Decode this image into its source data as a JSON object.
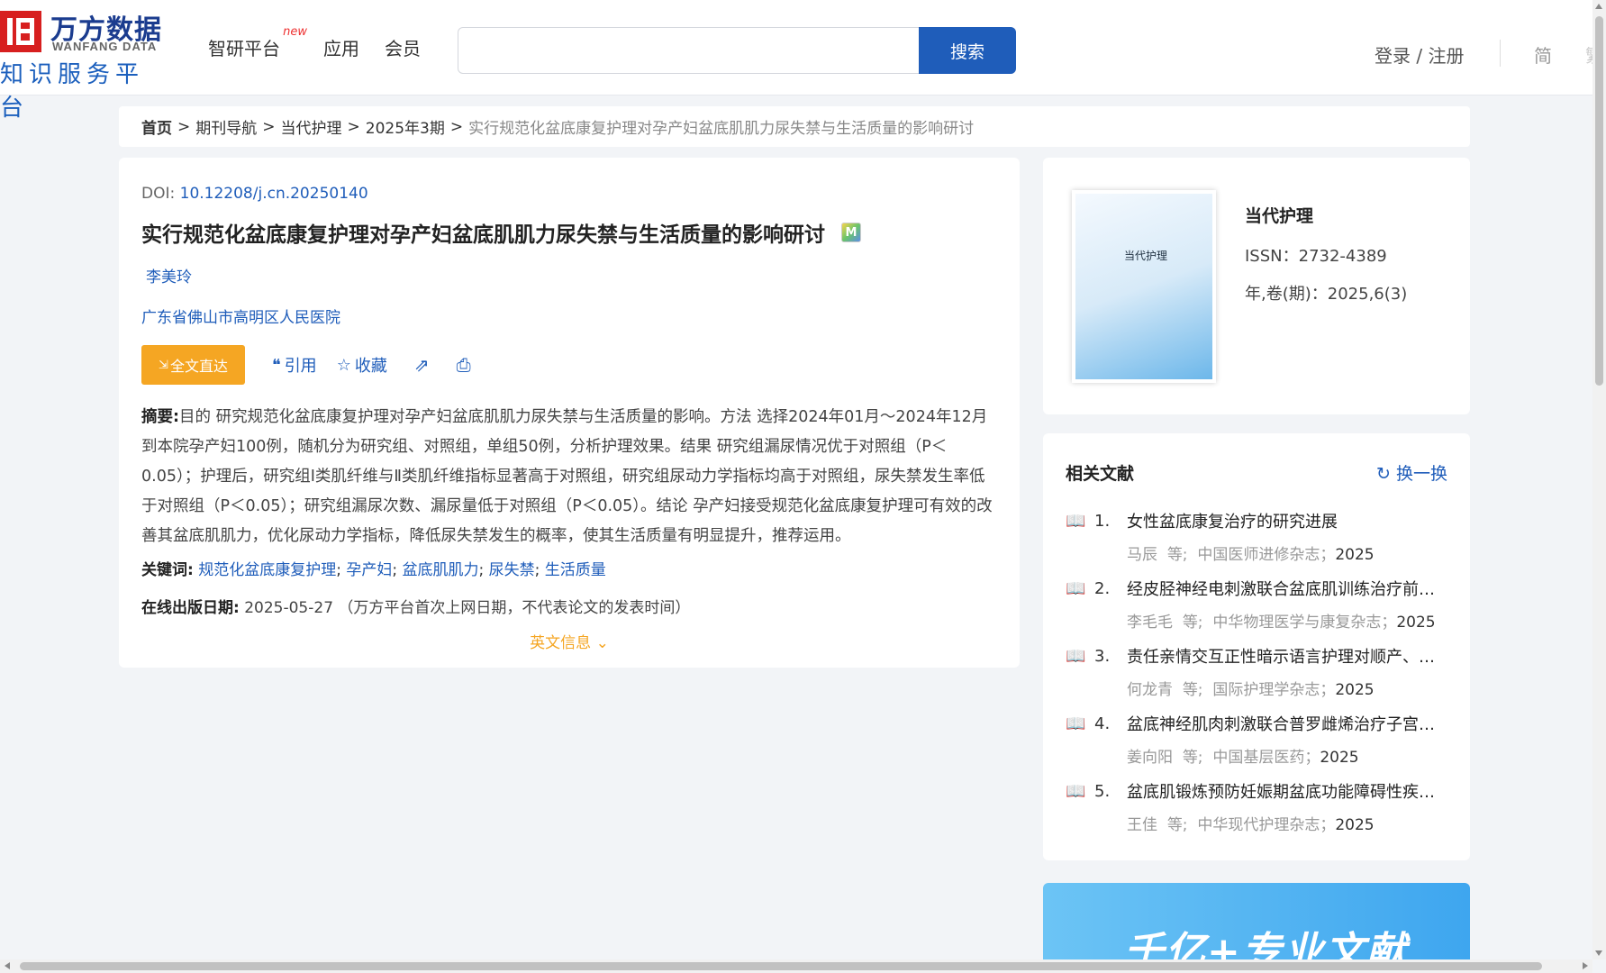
{
  "header": {
    "logo_cn": "万方数据",
    "logo_en": "WANFANG DATA",
    "logo_sub": "知识服务平台",
    "nav": [
      {
        "label": "智研平台",
        "tag": "new"
      },
      {
        "label": "应用"
      },
      {
        "label": "会员"
      }
    ],
    "search": {
      "placeholder": "",
      "button": "搜索"
    },
    "login": "登录 / 注册",
    "lang_simplified": "简",
    "lang_traditional": "繁"
  },
  "breadcrumb": {
    "home": "首页",
    "items": [
      "期刊导航",
      "当代护理",
      "2025年3期"
    ],
    "current": "实行规范化盆底康复护理对孕产妇盆底肌肌力尿失禁与生活质量的影响研讨",
    "sep": ">"
  },
  "article": {
    "doi_label": "DOI: ",
    "doi": "10.12208/j.cn.20250140",
    "title": "实行规范化盆底康复护理对孕产妇盆底肌肌力尿失禁与生活质量的影响研讨",
    "badge": "M",
    "author": "李美玲",
    "org": "广东省佛山市高明区人民医院",
    "actions": {
      "fulltext": "全文直达",
      "cite": "引用",
      "collect": "收藏"
    },
    "abstract_label": "摘要:",
    "abstract": "目的 研究规范化盆底康复护理对孕产妇盆底肌肌力尿失禁与生活质量的影响。方法 选择2024年01月～2024年12月到本院孕产妇100例，随机分为研究组、对照组，单组50例，分析护理效果。结果 研究组漏尿情况优于对照组（P＜0.05）；护理后，研究组Ⅰ类肌纤维与Ⅱ类肌纤维指标显著高于对照组，研究组尿动力学指标均高于对照组，尿失禁发生率低于对照组（P＜0.05）；研究组漏尿次数、漏尿量低于对照组（P＜0.05）。结论 孕产妇接受规范化盆底康复护理可有效的改善其盆底肌肌力，优化尿动力学指标，降低尿失禁发生的概率，使其生活质量有明显提升，推荐运用。",
    "keywords_label": "关键词:",
    "keywords": [
      "规范化盆底康复护理",
      "孕产妇",
      "盆底肌肌力",
      "尿失禁",
      "生活质量"
    ],
    "pubdate_label": "在线出版日期:",
    "pubdate": "2025-05-27",
    "pubdate_note": "（万方平台首次上网日期，不代表论文的发表时间）",
    "en_info": "英文信息"
  },
  "journal": {
    "cover_title": "当代护理",
    "name": "当代护理",
    "issn": "ISSN：2732-4389",
    "issue": "年,卷(期)：2025,6(3)"
  },
  "related": {
    "heading": "相关文献",
    "refresh": "换一换",
    "items": [
      {
        "num": "1.",
        "title": "女性盆底康复治疗的研究进展",
        "author": "马辰",
        "journal": "中国医师进修杂志",
        "year": "2025"
      },
      {
        "num": "2.",
        "title": "经皮胫神经电刺激联合盆底肌训练治疗前列...",
        "author": "李毛毛",
        "journal": "中华物理医学与康复杂志",
        "year": "2025"
      },
      {
        "num": "3.",
        "title": "责任亲情交互正性暗示语言护理对顺产、初...",
        "author": "何龙青",
        "journal": "国际护理学杂志",
        "year": "2025"
      },
      {
        "num": "4.",
        "title": "盆底神经肌肉刺激联合普罗雌烯治疗子宫切...",
        "author": "姜向阳",
        "journal": "中国基层医药",
        "year": "2025"
      },
      {
        "num": "5.",
        "title": "盆底肌锻炼预防妊娠期盆底功能障碍性疾病...",
        "author": "王佳",
        "journal": "中华现代护理杂志",
        "year": "2025"
      }
    ],
    "etal": "等;"
  },
  "banner": {
    "text": "千亿+专业文献"
  },
  "colors": {
    "primary": "#1f5dba",
    "accent": "#f5a623",
    "brand_red": "#d71f1f"
  }
}
